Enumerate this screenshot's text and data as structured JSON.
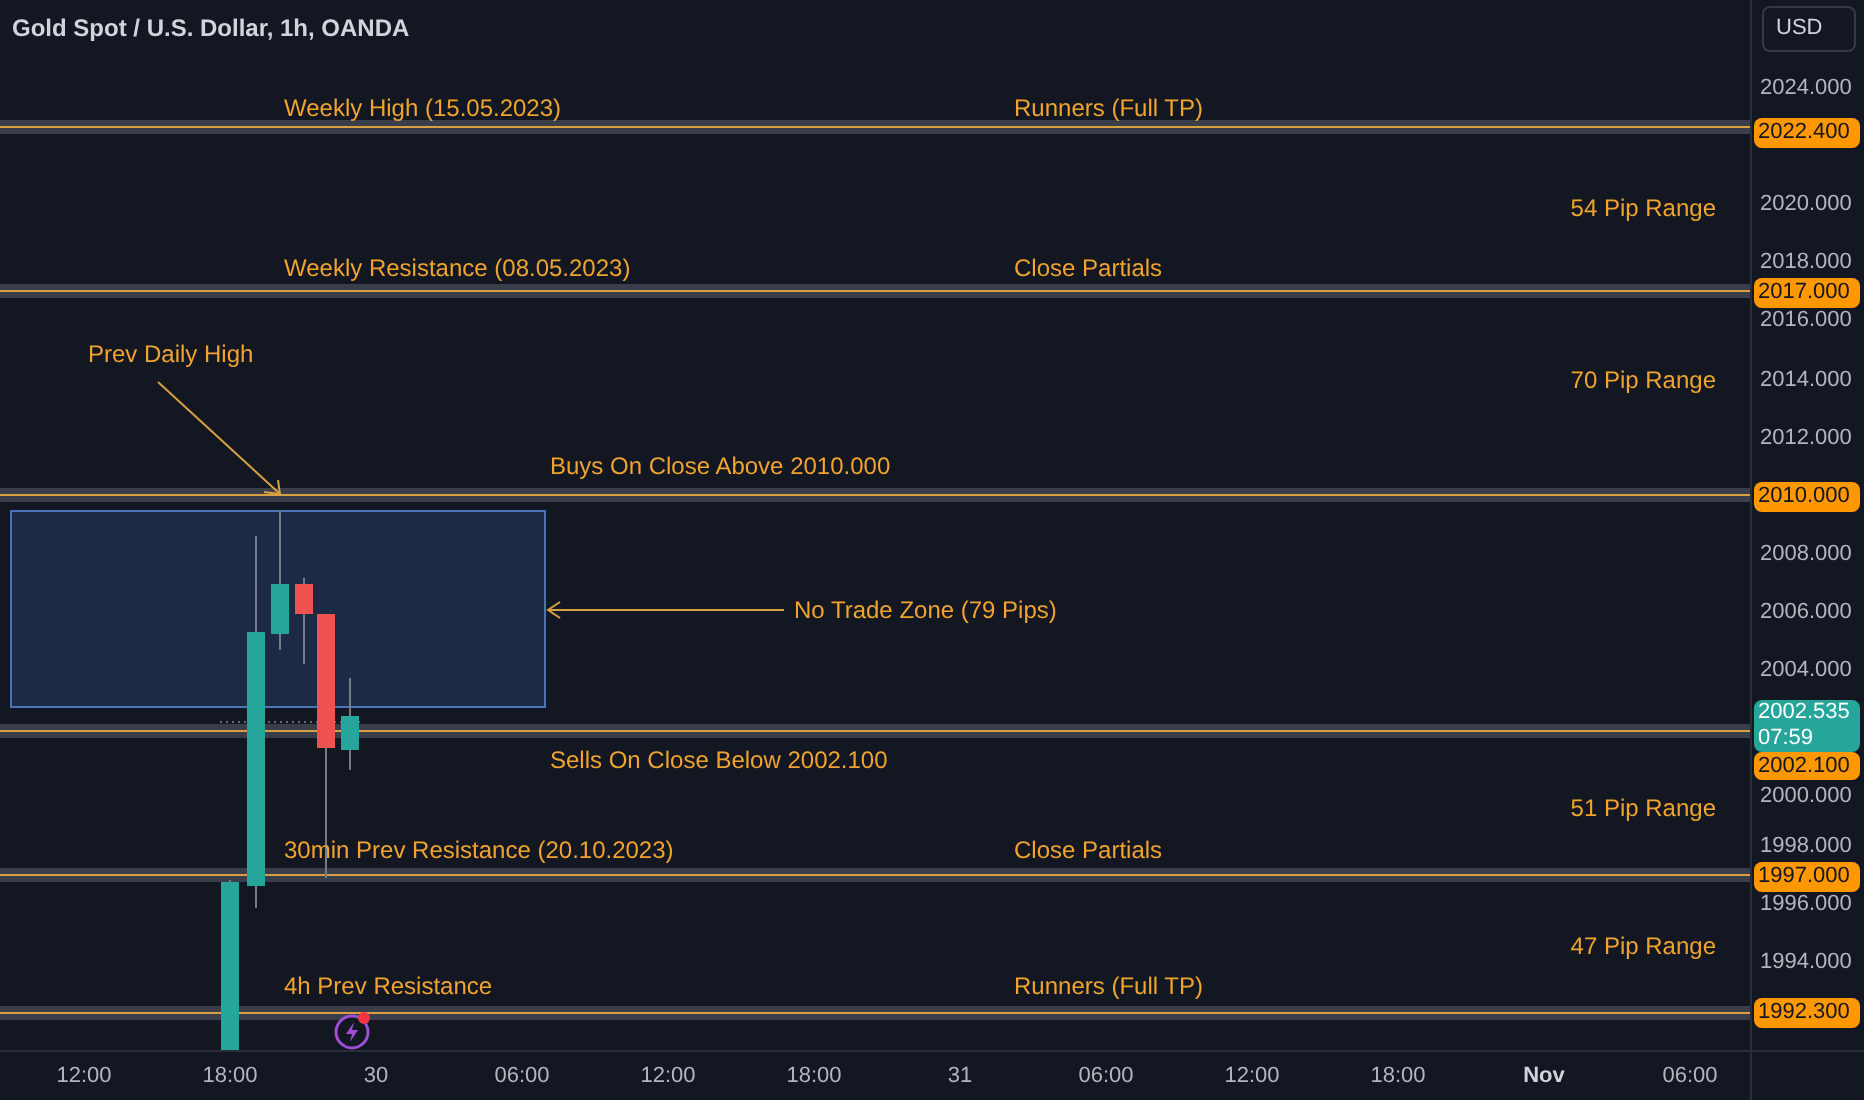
{
  "header": {
    "title": "Gold Spot / U.S. Dollar, 1h, OANDA"
  },
  "price_axis": {
    "currency": "USD",
    "ticks": [
      "2024.000",
      "2020.000",
      "2018.000",
      "2016.000",
      "2014.000",
      "2012.000",
      "2008.000",
      "2006.000",
      "2004.000",
      "2000.000",
      "1998.000",
      "1996.000",
      "1994.000"
    ],
    "last_price": "2002.535",
    "countdown": "07:59"
  },
  "levels": [
    {
      "price": "2022.400",
      "label_left": "Weekly High (15.05.2023)",
      "label_right": "Runners (Full TP)"
    },
    {
      "price": "2017.000",
      "label_left": "Weekly Resistance (08.05.2023)",
      "label_right": "Close Partials"
    },
    {
      "price": "2010.000",
      "label_left": "Buys On Close Above 2010.000"
    },
    {
      "price": "2002.100",
      "label_left": "Sells On Close Below 2002.100"
    },
    {
      "price": "1997.000",
      "label_left": "30min Prev Resistance (20.10.2023)",
      "label_right": "Close Partials"
    },
    {
      "price": "1992.300",
      "label_left": "4h Prev Resistance",
      "label_right": "Runners (Full TP)"
    }
  ],
  "range_labels": [
    "54 Pip Range",
    "70 Pip Range",
    "51 Pip Range",
    "47 Pip Range"
  ],
  "annotations": {
    "prev_daily_high": "Prev Daily High",
    "no_trade_zone": "No Trade Zone (79 Pips)"
  },
  "time_axis": {
    "ticks": [
      {
        "label": "12:00",
        "bold": false
      },
      {
        "label": "18:00",
        "bold": false
      },
      {
        "label": "30",
        "bold": false
      },
      {
        "label": "06:00",
        "bold": false
      },
      {
        "label": "12:00",
        "bold": false
      },
      {
        "label": "18:00",
        "bold": false
      },
      {
        "label": "31",
        "bold": false
      },
      {
        "label": "06:00",
        "bold": false
      },
      {
        "label": "12:00",
        "bold": false
      },
      {
        "label": "18:00",
        "bold": false
      },
      {
        "label": "Nov",
        "bold": true
      },
      {
        "label": "06:00",
        "bold": false
      }
    ]
  }
}
